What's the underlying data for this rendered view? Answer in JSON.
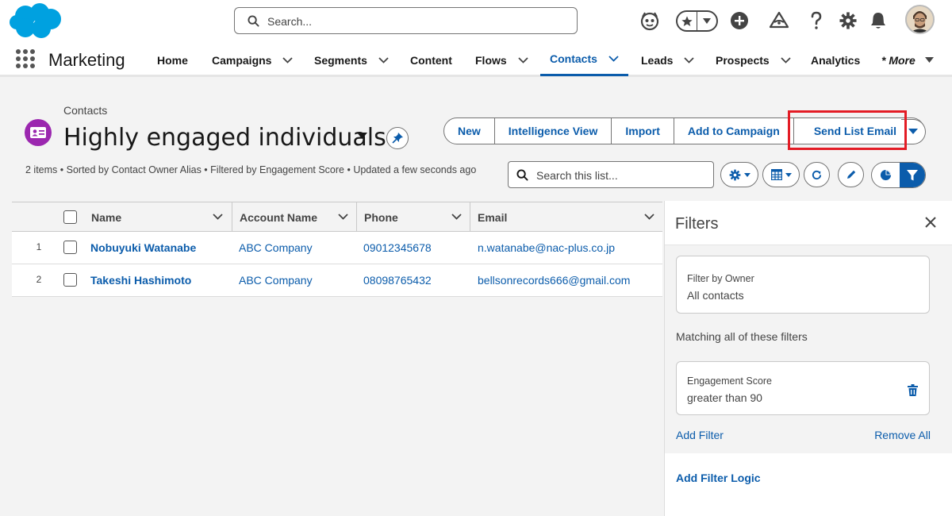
{
  "global_header": {
    "search_placeholder": "Search...",
    "icons": [
      "salesforce-logo",
      "einstein-icon",
      "favorites-star-icon",
      "favorites-list-icon",
      "global-actions-plus-icon",
      "trailhead-icon",
      "help-icon",
      "setup-gear-icon",
      "notifications-bell-icon",
      "user-avatar"
    ]
  },
  "app_nav": {
    "app_name": "Marketing",
    "items": [
      {
        "label": "Home",
        "has_menu": false,
        "active": false
      },
      {
        "label": "Campaigns",
        "has_menu": true,
        "active": false
      },
      {
        "label": "Segments",
        "has_menu": true,
        "active": false
      },
      {
        "label": "Content",
        "has_menu": false,
        "active": false
      },
      {
        "label": "Flows",
        "has_menu": true,
        "active": false
      },
      {
        "label": "Contacts",
        "has_menu": true,
        "active": true
      },
      {
        "label": "Leads",
        "has_menu": true,
        "active": false
      },
      {
        "label": "Prospects",
        "has_menu": true,
        "active": false
      },
      {
        "label": "Analytics",
        "has_menu": false,
        "active": false
      },
      {
        "label": "* More",
        "has_menu": true,
        "active": false
      }
    ]
  },
  "list_view": {
    "object_label": "Contacts",
    "title": "Highly engaged individuals",
    "meta": "2 items • Sorted by Contact Owner Alias • Filtered by Engagement Score • Updated a few seconds ago",
    "actions": [
      "New",
      "Intelligence View",
      "Import",
      "Add to Campaign",
      "Send List Email"
    ],
    "highlighted_action": "Send List Email",
    "search_placeholder": "Search this list..."
  },
  "table": {
    "columns": [
      "Name",
      "Account Name",
      "Phone",
      "Email"
    ],
    "rows": [
      {
        "num": "1",
        "name": "Nobuyuki Watanabe",
        "account": "ABC Company",
        "phone": "09012345678",
        "email": "n.watanabe@nac-plus.co.jp"
      },
      {
        "num": "2",
        "name": "Takeshi Hashimoto",
        "account": "ABC Company",
        "phone": "08098765432",
        "email": "bellsonrecords666@gmail.com"
      }
    ]
  },
  "filters": {
    "title": "Filters",
    "owner_label": "Filter by Owner",
    "owner_value": "All contacts",
    "matching_label": "Matching all of these filters",
    "filter_field": "Engagement Score",
    "filter_value": "greater than 90",
    "add_filter": "Add Filter",
    "remove_all": "Remove All",
    "add_logic": "Add Filter Logic"
  },
  "colors": {
    "brand_blue": "#0b5cab",
    "logo_blue": "#00a1e0",
    "contact_icon_purple": "#9b27af",
    "highlight_red": "#e31c25"
  }
}
